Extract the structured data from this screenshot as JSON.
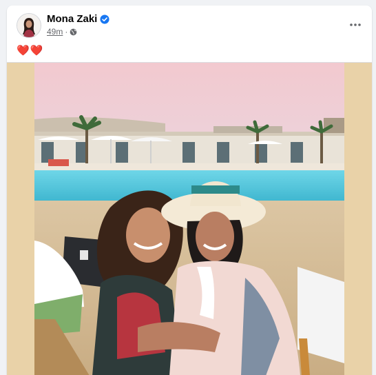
{
  "post": {
    "author_name": "Mona Zaki",
    "verified_icon": "verified-badge-icon",
    "timestamp": "49m",
    "separator": "·",
    "audience_icon": "globe-icon",
    "more_icon": "more-horizontal-icon",
    "caption": "❤️❤️",
    "colors": {
      "accent": "#1877f2",
      "text_primary": "#050505",
      "text_secondary": "#65676b",
      "media_border": "#e9d2a8"
    }
  }
}
